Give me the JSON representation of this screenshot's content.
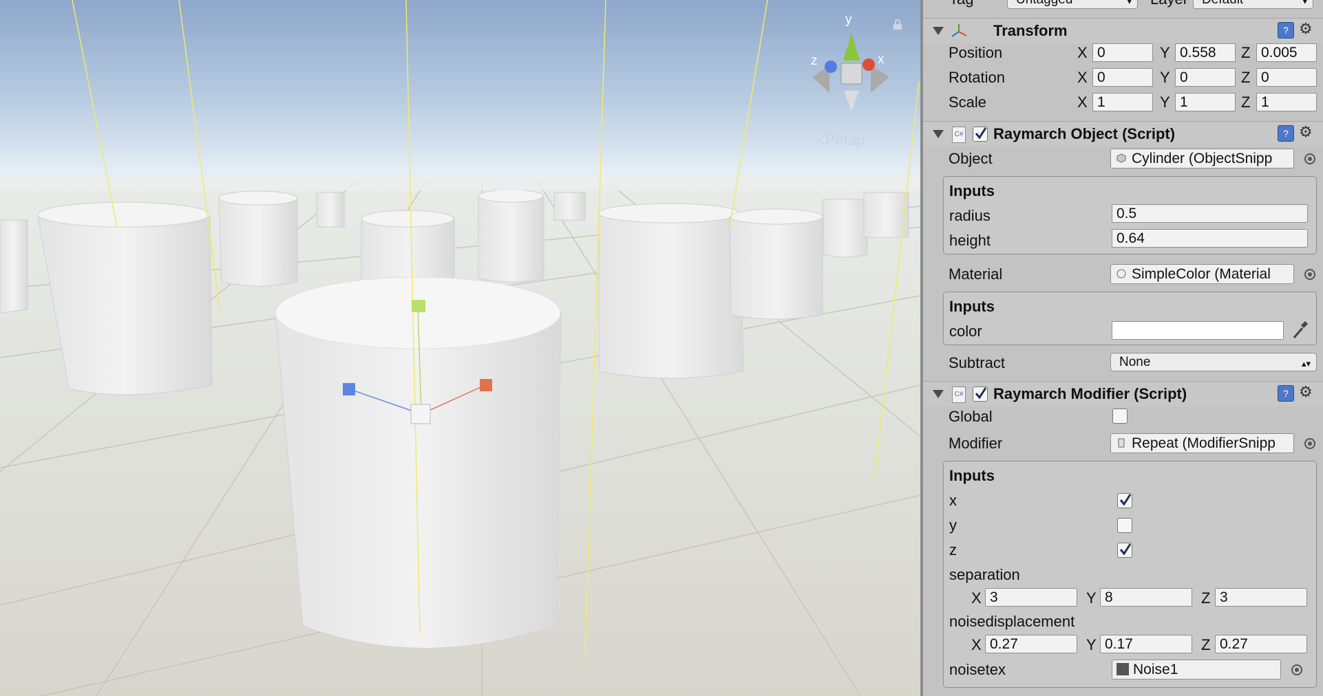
{
  "scene": {
    "view_label": "Persp",
    "gizmo_axes": {
      "x": "x",
      "y": "y",
      "z": "z"
    },
    "colors": {
      "sky_top": "#8fa8cc",
      "sky_horizon": "#eaf2f8",
      "floor": "#dcdcd4",
      "cylinder": "#ededed"
    }
  },
  "inspector": {
    "top_row": {
      "tag_label": "Tag",
      "tag_value": "Untagged",
      "layer_label": "Layer",
      "layer_value": "Default"
    },
    "transform": {
      "title": "Transform",
      "rows": [
        {
          "label": "Position",
          "x": "0",
          "y": "0.558",
          "z": "0.005"
        },
        {
          "label": "Rotation",
          "x": "0",
          "y": "0",
          "z": "0"
        },
        {
          "label": "Scale",
          "x": "1",
          "y": "1",
          "z": "1"
        }
      ],
      "axis": {
        "x": "X",
        "y": "Y",
        "z": "Z"
      }
    },
    "raymarch_object": {
      "title": "Raymarch Object (Script)",
      "enabled": true,
      "object_label": "Object",
      "object_value": "Cylinder (ObjectSnipp",
      "inputs_title": "Inputs",
      "radius_label": "radius",
      "radius_value": "0.5",
      "height_label": "height",
      "height_value": "0.64",
      "material_label": "Material",
      "material_value": "SimpleColor (Material",
      "inputs2_title": "Inputs",
      "color_label": "color",
      "color_value": "#ffffff",
      "subtract_label": "Subtract",
      "subtract_value": "None"
    },
    "raymarch_modifier": {
      "title": "Raymarch Modifier (Script)",
      "enabled": true,
      "global_label": "Global",
      "global_checked": false,
      "modifier_label": "Modifier",
      "modifier_value": "Repeat (ModifierSnipp",
      "inputs_title": "Inputs",
      "x_label": "x",
      "x_checked": true,
      "y_label": "y",
      "y_checked": false,
      "z_label": "z",
      "z_checked": true,
      "separation_label": "separation",
      "separation": {
        "x": "3",
        "y": "8",
        "z": "3"
      },
      "noise_label": "noisedisplacement",
      "noise": {
        "x": "0.27",
        "y": "0.17",
        "z": "0.27"
      },
      "noisetex_label": "noisetex",
      "noisetex_value": "Noise1"
    }
  }
}
